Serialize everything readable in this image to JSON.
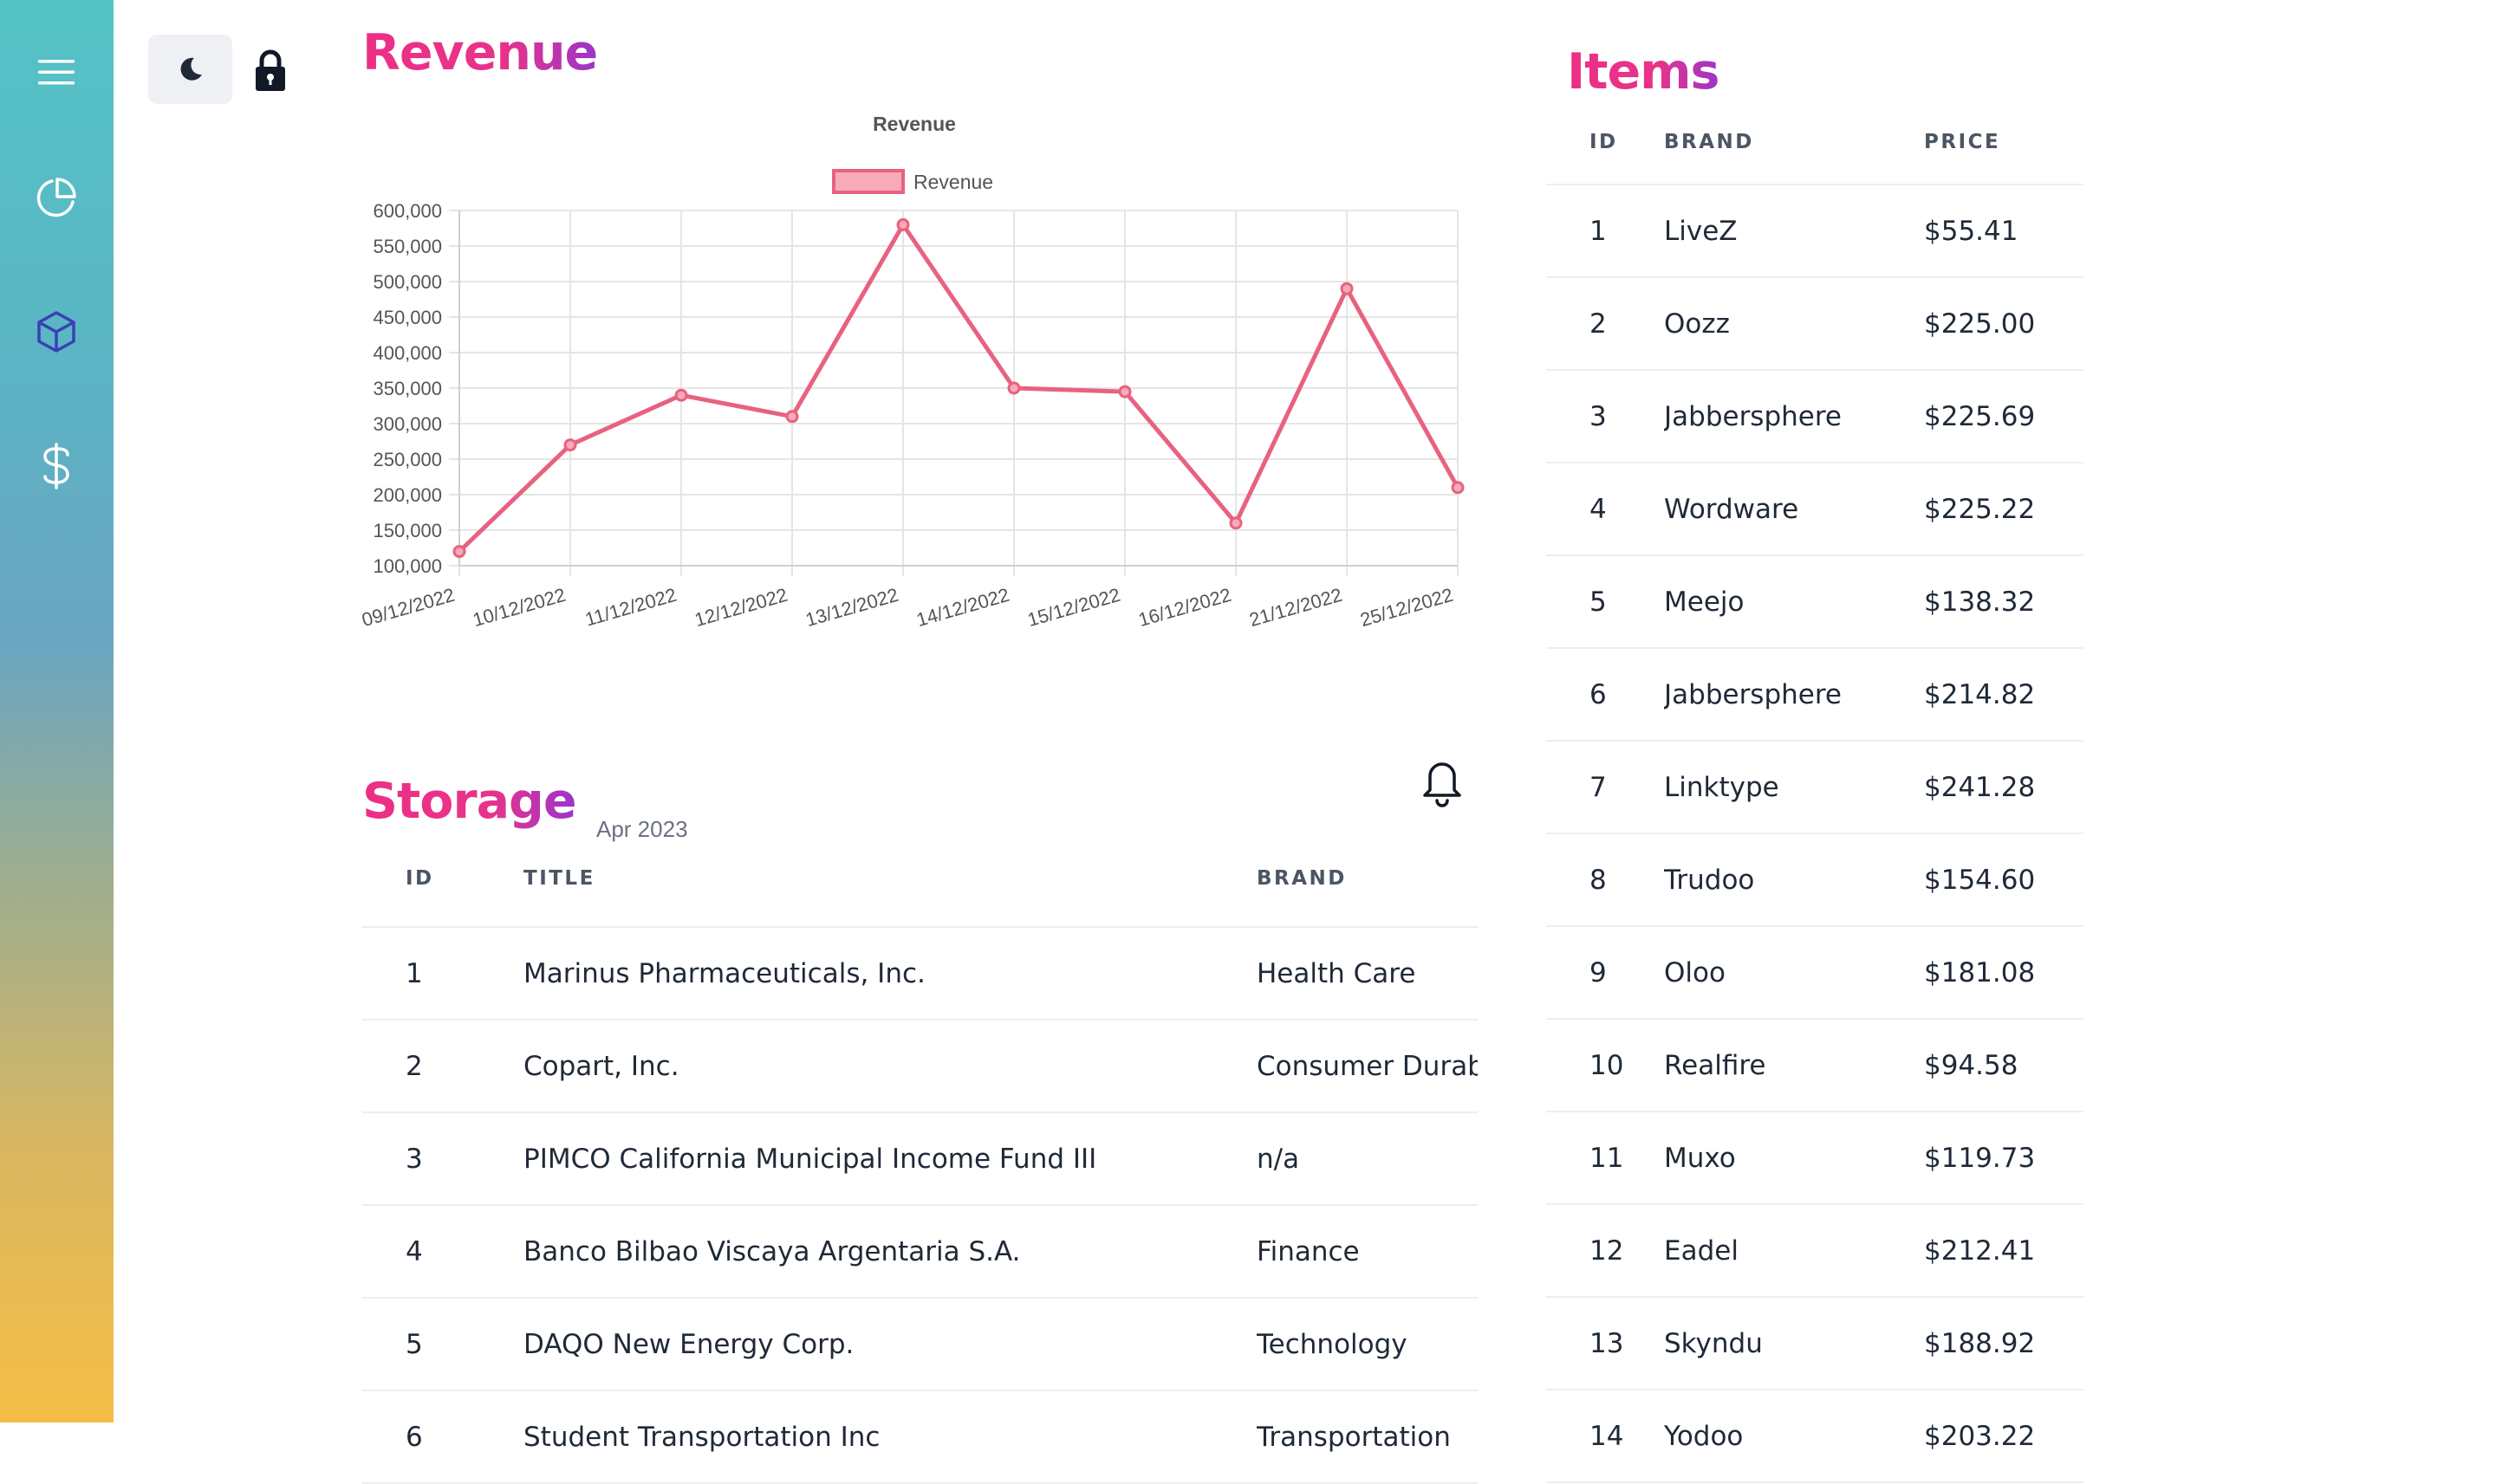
{
  "sidebar": {
    "items": [
      {
        "icon": "menu-icon"
      },
      {
        "icon": "pie-chart-icon"
      },
      {
        "icon": "cube-icon",
        "active_color": "#3b3fb6"
      },
      {
        "icon": "dollar-icon"
      }
    ]
  },
  "topbar": {
    "theme_icon": "moon-icon",
    "lock_icon": "lock-icon"
  },
  "revenue": {
    "heading": "Revenue",
    "chart_data": {
      "type": "line",
      "title": "Revenue",
      "legend": "Revenue",
      "legend_position": "top",
      "x": [
        "09/12/2022",
        "10/12/2022",
        "11/12/2022",
        "12/12/2022",
        "13/12/2022",
        "14/12/2022",
        "15/12/2022",
        "16/12/2022",
        "21/12/2022",
        "25/12/2022"
      ],
      "series": [
        {
          "name": "Revenue",
          "values": [
            120000,
            270000,
            340000,
            310000,
            580000,
            350000,
            345000,
            160000,
            490000,
            210000
          ]
        }
      ],
      "ylim": [
        100000,
        600000
      ],
      "yticks": [
        "600,000",
        "550,000",
        "500,000",
        "450,000",
        "400,000",
        "350,000",
        "300,000",
        "250,000",
        "200,000",
        "150,000",
        "100,000"
      ],
      "ytick_values": [
        600000,
        550000,
        500000,
        450000,
        400000,
        350000,
        300000,
        250000,
        200000,
        150000,
        100000
      ],
      "grid": true,
      "line_color": "#e8627f",
      "fill_color": "#f7aab8"
    }
  },
  "storage": {
    "heading": "Storage",
    "date": "Apr 2023",
    "bell_icon": "bell-icon",
    "columns": [
      "ID",
      "TITLE",
      "BRAND"
    ],
    "rows": [
      [
        "1",
        "Marinus Pharmaceuticals, Inc.",
        "Health Care"
      ],
      [
        "2",
        "Copart, Inc.",
        "Consumer Durab"
      ],
      [
        "3",
        "PIMCO California Municipal Income Fund III",
        "n/a"
      ],
      [
        "4",
        "Banco Bilbao Viscaya Argentaria S.A.",
        "Finance"
      ],
      [
        "5",
        "DAQO New Energy Corp.",
        "Technology"
      ],
      [
        "6",
        "Student Transportation Inc",
        "Transportation"
      ]
    ]
  },
  "items": {
    "heading": "Items",
    "columns": [
      "ID",
      "BRAND",
      "PRICE"
    ],
    "rows": [
      [
        "1",
        "LiveZ",
        "$55.41"
      ],
      [
        "2",
        "Oozz",
        "$225.00"
      ],
      [
        "3",
        "Jabbersphere",
        "$225.69"
      ],
      [
        "4",
        "Wordware",
        "$225.22"
      ],
      [
        "5",
        "Meejo",
        "$138.32"
      ],
      [
        "6",
        "Jabbersphere",
        "$214.82"
      ],
      [
        "7",
        "Linktype",
        "$241.28"
      ],
      [
        "8",
        "Trudoo",
        "$154.60"
      ],
      [
        "9",
        "Oloo",
        "$181.08"
      ],
      [
        "10",
        "Realfire",
        "$94.58"
      ],
      [
        "11",
        "Muxo",
        "$119.73"
      ],
      [
        "12",
        "Eadel",
        "$212.41"
      ],
      [
        "13",
        "Skyndu",
        "$188.92"
      ],
      [
        "14",
        "Yodoo",
        "$203.22"
      ]
    ]
  }
}
